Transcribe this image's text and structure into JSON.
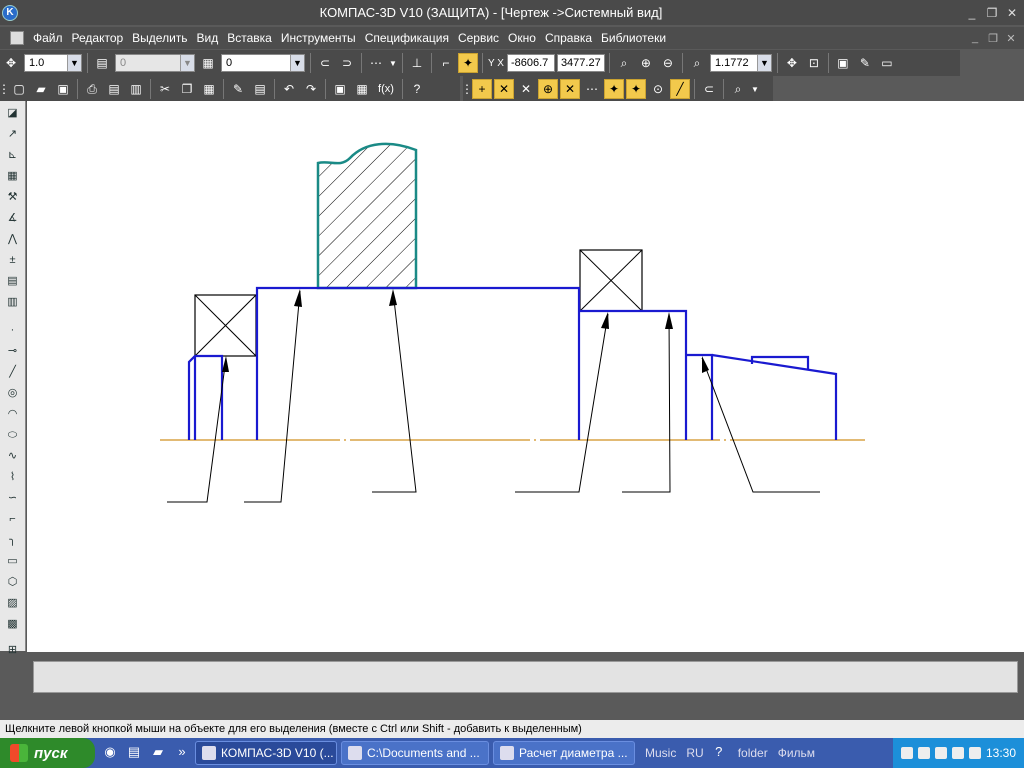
{
  "window": {
    "title": "КОМПАС-3D V10 (ЗАЩИТА) - [Чертеж ->Системный вид]",
    "app_icon": "kompas-icon",
    "controls": [
      "_",
      "❐",
      "✕"
    ]
  },
  "menu": {
    "items": [
      "Файл",
      "Редактор",
      "Выделить",
      "Вид",
      "Вставка",
      "Инструменты",
      "Спецификация",
      "Сервис",
      "Окно",
      "Справка",
      "Библиотеки"
    ],
    "doc_controls": [
      "_",
      "❐",
      "✕"
    ]
  },
  "toolbar_top": {
    "step_value": "1.0",
    "layer_combo": "0",
    "style_combo": "0",
    "coord_x": "-8606.7",
    "coord_y": "3477.27",
    "zoom": "1.1772",
    "yx_label": "Y X"
  },
  "toolbar_second": {
    "fx_label": "f(x)",
    "help_label": "?"
  },
  "left_tools": [
    "geometry",
    "dimensions",
    "notation",
    "edit",
    "parametrize",
    "measure",
    "select",
    "spec",
    "reports",
    "insert",
    "fragment-lib"
  ],
  "drawing": {
    "line_color": "#1a1ad0",
    "hatch_border_color": "#1a8a86",
    "axis_color": "#d09020",
    "leader_color": "#000000"
  },
  "status_text": "Щелкните левой кнопкой мыши на объекте для его выделения (вместе с Ctrl или Shift - добавить к выделенным)",
  "taskbar": {
    "start_label": "пуск",
    "tasks": [
      {
        "label": "КОМПАС-3D V10 (..."
      },
      {
        "label": "C:\\Documents and ..."
      },
      {
        "label": "Расчет диаметра ..."
      }
    ],
    "tray_labels": [
      "Music",
      "RU",
      "folder",
      "Фильм"
    ],
    "clock": "13:30",
    "chevron": "»"
  }
}
